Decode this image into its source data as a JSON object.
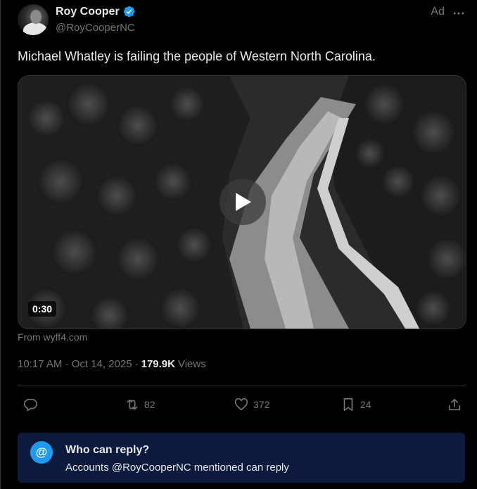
{
  "author": {
    "display_name": "Roy Cooper",
    "handle": "@RoyCooperNC",
    "verified": true
  },
  "ad_label": "Ad",
  "tweet": {
    "text": "Michael Whatley is failing the people of Western North Carolina.",
    "video_duration": "0:30",
    "source": "From wyff4.com",
    "time": "10:17 AM · Oct 14, 2025",
    "separator": "·",
    "views_count": "179.9K",
    "views_label": "Views"
  },
  "actions": {
    "reply_count": "",
    "retweet_count": "82",
    "like_count": "372",
    "bookmark_count": "24"
  },
  "reply_restriction": {
    "title": "Who can reply?",
    "description": "Accounts @RoyCooperNC mentioned can reply",
    "icon_glyph": "@"
  },
  "colors": {
    "accent": "#1d9bf0",
    "muted": "#71767b",
    "text": "#e7e9ea",
    "reply_box_bg": "#0b1a3d"
  }
}
